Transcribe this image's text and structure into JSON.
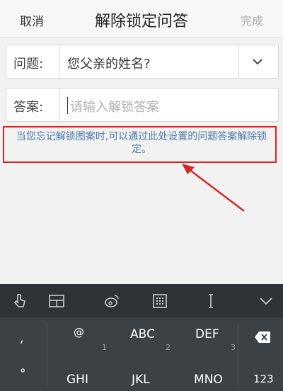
{
  "header": {
    "cancel": "取消",
    "title": "解除锁定问答",
    "done": "完成"
  },
  "question": {
    "label": "问题:",
    "value": "您父亲的姓名?"
  },
  "answer": {
    "label": "答案:",
    "placeholder": "请输入解锁答案",
    "value": ""
  },
  "hint": "当您忘记解锁图案时,可以通过此处设置的问题答案解除锁定。",
  "keyboard": {
    "toolbar": [
      "gesture-hand-icon",
      "keyboard-layout-icon",
      "weibo-icon",
      "numpad-icon",
      "cursor-icon",
      "collapse-keyboard-icon"
    ],
    "row1": [
      {
        "main": ",",
        "sub": ""
      },
      {
        "main": "@",
        "sub": "1"
      },
      {
        "main": "ABC",
        "sub": "2"
      },
      {
        "main": "DEF",
        "sub": "3"
      },
      {
        "main": "⌫",
        "sub": ""
      }
    ],
    "row2": [
      {
        "main": "°",
        "sub": ""
      },
      {
        "main": "GHI",
        "sub": ""
      },
      {
        "main": "JKL",
        "sub": ""
      },
      {
        "main": "MNO",
        "sub": ""
      },
      {
        "main": "123",
        "sub": ""
      }
    ]
  },
  "colors": {
    "highlight": "#e02020",
    "hint_text": "#4a7aa8",
    "keyboard_bg": "#3c4146"
  }
}
